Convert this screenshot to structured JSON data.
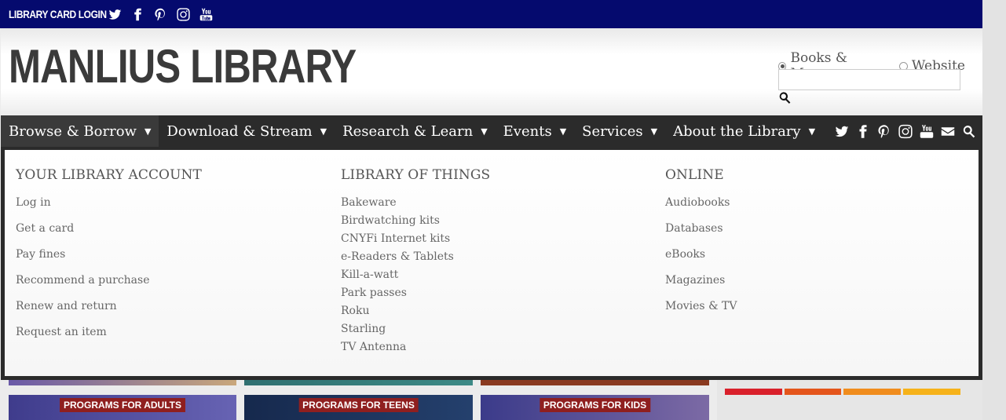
{
  "topbar": {
    "login_label": "LIBRARY CARD LOGIN",
    "social": [
      "twitter-icon",
      "facebook-icon",
      "pinterest-icon",
      "instagram-icon",
      "youtube-icon"
    ],
    "background": "#050a6e"
  },
  "header": {
    "site_title": "MANLIUS LIBRARY",
    "search": {
      "options": [
        {
          "label": "Books & More",
          "selected": true
        },
        {
          "label": "Website",
          "selected": false
        }
      ],
      "value": "",
      "button_icon": "search-icon"
    }
  },
  "nav": {
    "items": [
      {
        "label": "Browse & Borrow",
        "active": true
      },
      {
        "label": "Download & Stream",
        "active": false
      },
      {
        "label": "Research & Learn",
        "active": false
      },
      {
        "label": "Events",
        "active": false
      },
      {
        "label": "Services",
        "active": false
      },
      {
        "label": "About the Library",
        "active": false
      }
    ],
    "social": [
      "twitter-icon",
      "facebook-icon",
      "pinterest-icon",
      "instagram-icon",
      "youtube-icon",
      "envelope-icon",
      "search-icon"
    ]
  },
  "mega_menu": {
    "columns": [
      {
        "heading": "YOUR LIBRARY ACCOUNT",
        "items": [
          "Log in",
          "Get a card",
          "Pay fines",
          "Recommend a purchase",
          "Renew and return",
          "Request an item"
        ]
      },
      {
        "heading": "LIBRARY OF THINGS",
        "items": [
          "Bakeware",
          "Birdwatching kits",
          "CNYFi Internet kits",
          "e-Readers & Tablets",
          "Kill-a-watt",
          "Park passes",
          "Roku",
          "Starling",
          "TV Antenna"
        ]
      },
      {
        "heading": "ONLINE",
        "items": [
          "Audiobooks",
          "Databases",
          "eBooks",
          "Magazines",
          "Movies & TV"
        ]
      }
    ]
  },
  "promos": [
    {
      "label": "PROGRAMS FOR ADULTS"
    },
    {
      "label": "PROGRAMS FOR TEENS"
    },
    {
      "label": "PROGRAMS FOR KIDS"
    }
  ],
  "colors": {
    "nav_bg": "#2b2b2b",
    "promo_tag": "#8f1f1f",
    "bars": [
      "#d9202b",
      "#e4551b",
      "#f08c1d",
      "#f6b21a"
    ]
  }
}
